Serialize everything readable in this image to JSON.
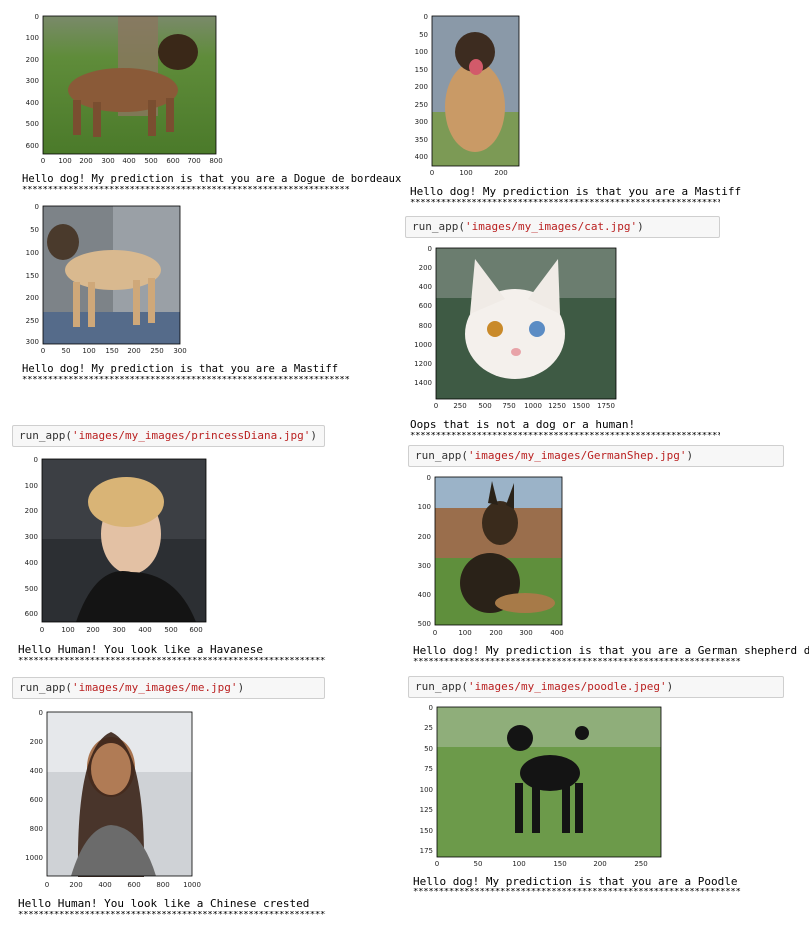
{
  "cells": [
    {
      "id": "dogue",
      "code": null,
      "image": {
        "subject": "dogue-de-bordeaux-dog-photo",
        "x_ticks": [
          "0",
          "100",
          "200",
          "300",
          "400",
          "500",
          "600",
          "700",
          "800"
        ],
        "y_ticks": [
          "0",
          "100",
          "200",
          "300",
          "400",
          "500",
          "600"
        ]
      },
      "output": "Hello dog! My prediction is that you are a Dogue de bordeaux",
      "stars": "****************************************************************"
    },
    {
      "id": "mastiff-1",
      "code": null,
      "image": {
        "subject": "mastiff-sitting-photo",
        "x_ticks": [
          "0",
          "100",
          "200"
        ],
        "y_ticks": [
          "0",
          "50",
          "100",
          "150",
          "200",
          "250",
          "300",
          "350",
          "400"
        ]
      },
      "output": "Hello dog! My prediction is that you are a Mastiff",
      "stars": "****************************************************************"
    },
    {
      "id": "mastiff-2",
      "code": null,
      "image": {
        "subject": "mastiff-standing-photo",
        "x_ticks": [
          "0",
          "50",
          "100",
          "150",
          "200",
          "250",
          "300"
        ],
        "y_ticks": [
          "0",
          "50",
          "100",
          "150",
          "200",
          "250",
          "300"
        ]
      },
      "output": "Hello dog! My prediction is that you are a Mastiff",
      "stars": "****************************************************************"
    },
    {
      "id": "cat",
      "code": {
        "fn": "run_app(",
        "arg": "'images/my_images/cat.jpg'",
        "close": ")"
      },
      "image": {
        "subject": "white-cat-photo",
        "x_ticks": [
          "0",
          "250",
          "500",
          "750",
          "1000",
          "1250",
          "1500",
          "1750"
        ],
        "y_ticks": [
          "0",
          "200",
          "400",
          "600",
          "800",
          "1000",
          "1200",
          "1400"
        ]
      },
      "output": "Oops that is not a dog or a human!",
      "stars": "****************************************************************"
    },
    {
      "id": "diana",
      "code": {
        "fn": "run_app(",
        "arg": "'images/my_images/princessDiana.jpg'",
        "close": ")"
      },
      "image": {
        "subject": "woman-portrait-photo",
        "x_ticks": [
          "0",
          "100",
          "200",
          "300",
          "400",
          "500",
          "600"
        ],
        "y_ticks": [
          "0",
          "100",
          "200",
          "300",
          "400",
          "500",
          "600"
        ]
      },
      "output": "Hello Human! You look like a Havanese",
      "stars": "****************************************************************"
    },
    {
      "id": "gshep",
      "code": {
        "fn": "run_app(",
        "arg": "'images/my_images/GermanShep.jpg'",
        "close": ")"
      },
      "image": {
        "subject": "german-shepherd-photo",
        "x_ticks": [
          "0",
          "100",
          "200",
          "300",
          "400"
        ],
        "y_ticks": [
          "0",
          "100",
          "200",
          "300",
          "400",
          "500"
        ]
      },
      "output": "Hello dog! My prediction is that you are a German shepherd dog",
      "stars": "****************************************************************"
    },
    {
      "id": "me",
      "code": {
        "fn": "run_app(",
        "arg": "'images/my_images/me.jpg'",
        "close": ")"
      },
      "image": {
        "subject": "woman-selfie-photo",
        "x_ticks": [
          "0",
          "200",
          "400",
          "600",
          "800",
          "1000"
        ],
        "y_ticks": [
          "0",
          "200",
          "400",
          "600",
          "800",
          "1000"
        ]
      },
      "output": "Hello Human! You look like a Chinese crested",
      "stars": "****************************************************************"
    },
    {
      "id": "poodle",
      "code": {
        "fn": "run_app(",
        "arg": "'images/my_images/poodle.jpeg'",
        "close": ")"
      },
      "image": {
        "subject": "black-poodle-photo",
        "x_ticks": [
          "0",
          "50",
          "100",
          "150",
          "200",
          "250"
        ],
        "y_ticks": [
          "0",
          "25",
          "50",
          "75",
          "100",
          "125",
          "150",
          "175"
        ]
      },
      "output": "Hello dog! My prediction is that you are a Poodle",
      "stars": "****************************************************************"
    }
  ]
}
